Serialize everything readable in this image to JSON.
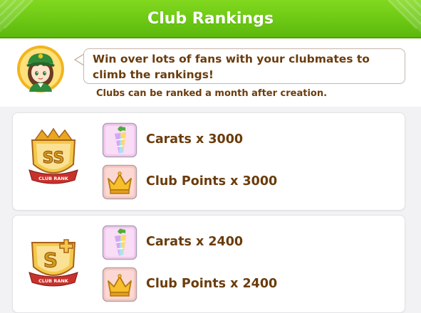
{
  "header": {
    "title": "Club Rankings"
  },
  "intro": {
    "message": "Win over lots of fans with your clubmates to climb the rankings!",
    "note": "Clubs can be ranked a month after creation."
  },
  "tiers": [
    {
      "rank": "SS",
      "badge_caption": "CLUB RANK",
      "rewards": [
        {
          "icon": "carat-icon",
          "label": "Carats x 3000"
        },
        {
          "icon": "crown-icon",
          "label": "Club Points x 3000"
        }
      ]
    },
    {
      "rank": "S",
      "badge_caption": "CLUB RANK",
      "rewards": [
        {
          "icon": "carat-icon",
          "label": "Carats x 2400"
        },
        {
          "icon": "crown-icon",
          "label": "Club Points x 2400"
        }
      ]
    }
  ],
  "colors": {
    "header_green": "#6cc814",
    "text_brown": "#6b3c0c",
    "badge_gold": "#e7b52c",
    "badge_ribbon_red": "#c8322c"
  }
}
